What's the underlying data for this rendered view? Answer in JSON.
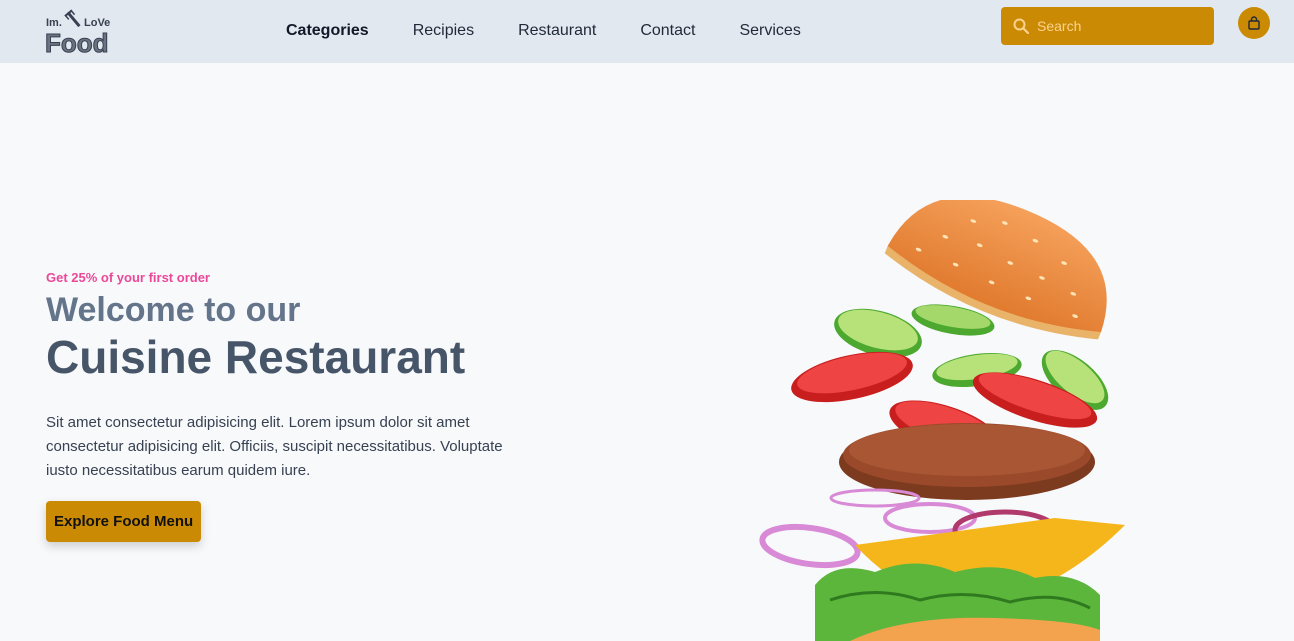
{
  "brand": {
    "logo_top_left": "Im.",
    "logo_top_right": "LoVe",
    "logo_bottom": "Food"
  },
  "nav": {
    "items": [
      {
        "label": "Categories",
        "active": true
      },
      {
        "label": "Recipies",
        "active": false
      },
      {
        "label": "Restaurant",
        "active": false
      },
      {
        "label": "Contact",
        "active": false
      },
      {
        "label": "Services",
        "active": false
      }
    ]
  },
  "search": {
    "placeholder": "Search",
    "icon": "search-icon"
  },
  "cart": {
    "icon": "shopping-bag-icon"
  },
  "hero": {
    "promo": "Get 25% of your first order",
    "welcome": "Welcome to our",
    "headline": "Cuisine Restaurant",
    "description": "Sit amet consectetur adipisicing elit. Lorem ipsum dolor sit amet consectetur adipisicing elit. Officiis, suscipit necessitatibus. Voluptate iusto necessitatibus earum quidem iure.",
    "cta_label": "Explore Food Menu"
  },
  "colors": {
    "accent": "#ca8a04",
    "nav_bg": "#e2e8f0",
    "promo": "#ec4899",
    "headline": "#475569"
  }
}
